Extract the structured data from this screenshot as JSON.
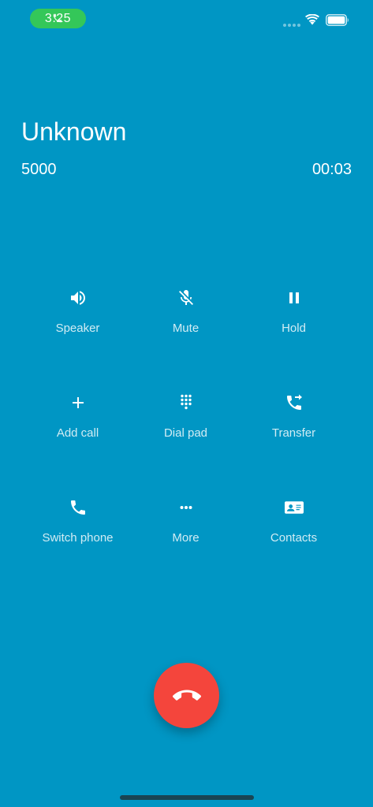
{
  "status_bar": {
    "time": "3:25",
    "pill_color": "#34c759",
    "icons": [
      "phone-icon",
      "cellular-signal-icon",
      "wifi-icon",
      "battery-icon"
    ]
  },
  "caller": {
    "name": "Unknown",
    "number": "5000",
    "duration": "00:03"
  },
  "controls": [
    {
      "label": "Speaker",
      "icon": "speaker-icon"
    },
    {
      "label": "Mute",
      "icon": "mic-off-icon"
    },
    {
      "label": "Hold",
      "icon": "pause-icon"
    },
    {
      "label": "Add call",
      "icon": "plus-icon"
    },
    {
      "label": "Dial pad",
      "icon": "dialpad-icon"
    },
    {
      "label": "Transfer",
      "icon": "call-transfer-icon"
    },
    {
      "label": "Switch phone",
      "icon": "phone-icon"
    },
    {
      "label": "More",
      "icon": "more-dots-icon"
    },
    {
      "label": "Contacts",
      "icon": "contact-card-icon"
    }
  ],
  "end_call": {
    "icon": "hang-up-icon",
    "color": "#f4453c"
  },
  "theme": {
    "background": "#0096c4",
    "text": "#ffffff"
  }
}
